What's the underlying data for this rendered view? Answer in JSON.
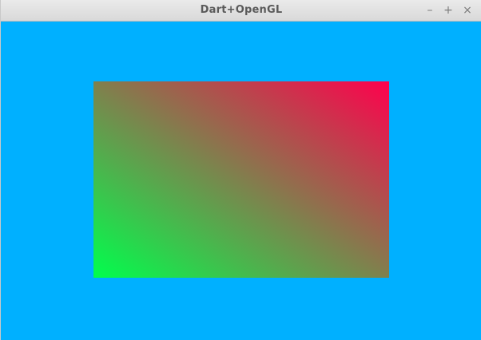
{
  "window": {
    "title": "Dart+OpenGL",
    "controls": {
      "minimize_glyph": "–",
      "maximize_glyph": "+",
      "close_glyph": "×"
    }
  },
  "scene": {
    "clear_color": "#00b0ff",
    "quad_corner_colors": {
      "top_left": "#0000ff",
      "top_right": "#ff0000",
      "bottom_left": "#00ff00",
      "bottom_right": "#0000ff"
    }
  }
}
